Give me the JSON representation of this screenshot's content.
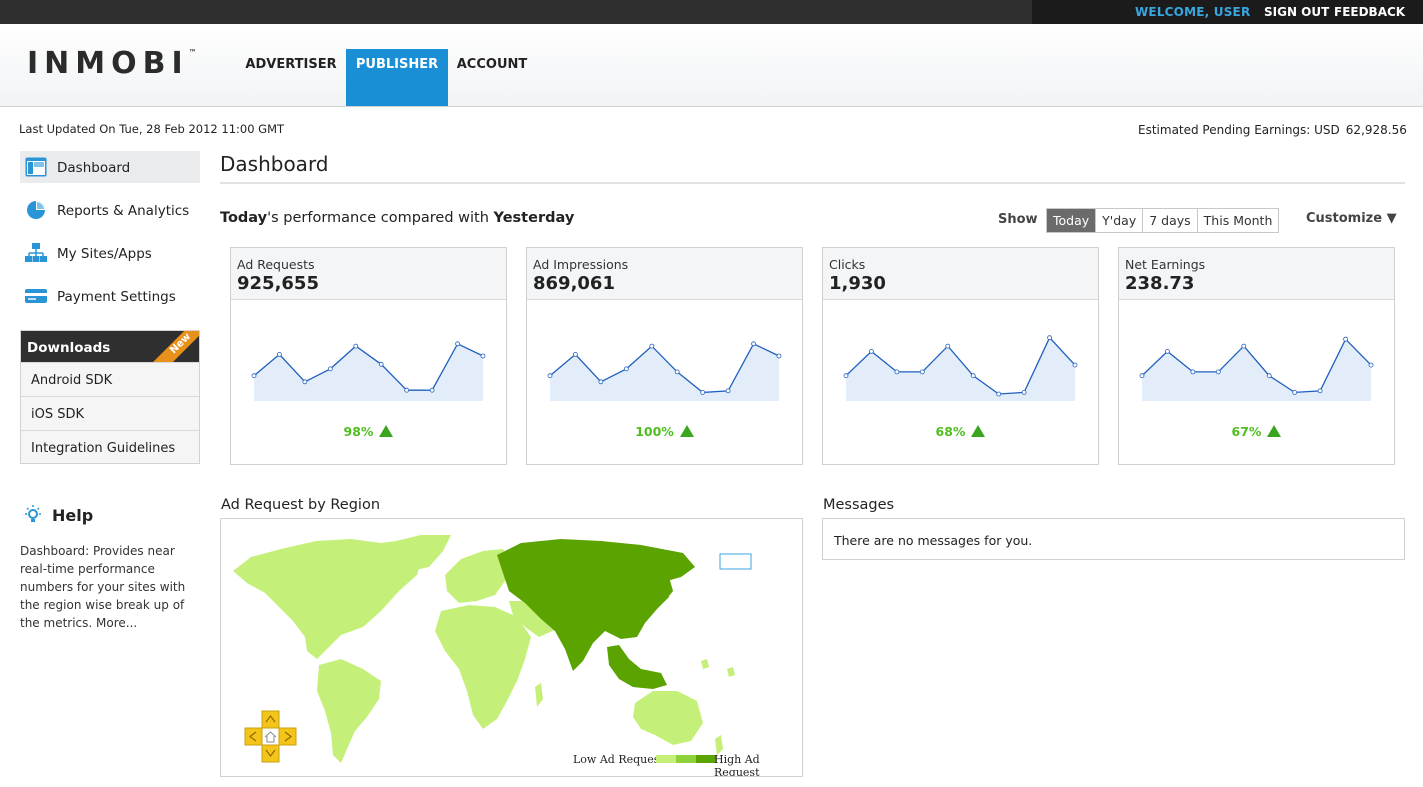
{
  "topbar": {
    "welcome": "WELCOME, USER",
    "sign_out": "SIGN OUT",
    "feedback": "FEEDBACK"
  },
  "header": {
    "logo_text": "INMOBI",
    "logo_tm": "™",
    "tabs": [
      {
        "label": "ADVERTISER",
        "active": false
      },
      {
        "label": "PUBLISHER",
        "active": true
      },
      {
        "label": "ACCOUNT",
        "active": false
      }
    ]
  },
  "status": {
    "last_updated": "Last Updated On Tue, 28 Feb 2012 11:00 GMT",
    "earnings_label": "Estimated Pending Earnings: USD",
    "earnings_value": "62,928.56"
  },
  "sidebar": {
    "items": [
      {
        "label": "Dashboard",
        "icon": "dashboard-icon",
        "active": true
      },
      {
        "label": "Reports & Analytics",
        "icon": "pie-chart-icon",
        "active": false
      },
      {
        "label": "My Sites/Apps",
        "icon": "sitemap-icon",
        "active": false
      },
      {
        "label": "Payment Settings",
        "icon": "credit-card-icon",
        "active": false
      }
    ],
    "downloads": {
      "title": "Downloads",
      "badge": "New",
      "items": [
        "Android SDK",
        "iOS SDK",
        "Integration Guidelines"
      ]
    },
    "help": {
      "title": "Help",
      "text": "Dashboard: Provides near real-time performance numbers for your sites with the region wise break up of the metrics. More..."
    }
  },
  "main": {
    "title": "Dashboard",
    "perf_bold_1": "Today",
    "perf_mid": "'s performance compared with ",
    "perf_bold_2": "Yesterday",
    "show_label": "Show",
    "ranges": [
      {
        "label": "Today",
        "active": true
      },
      {
        "label": "Y'day",
        "active": false
      },
      {
        "label": "7 days",
        "active": false
      },
      {
        "label": "This Month",
        "active": false
      }
    ],
    "customize": "Customize ▼",
    "metrics": [
      {
        "name": "Ad Requests",
        "value": "925,655",
        "change": "98%",
        "trend": [
          0.28,
          0.56,
          0.2,
          0.37,
          0.67,
          0.43,
          0.09,
          0.09,
          0.7,
          0.54
        ]
      },
      {
        "name": "Ad Impressions",
        "value": "869,061",
        "change": "100%",
        "trend": [
          0.28,
          0.56,
          0.2,
          0.37,
          0.67,
          0.33,
          0.06,
          0.08,
          0.7,
          0.54
        ]
      },
      {
        "name": "Clicks",
        "value": "1,930",
        "change": "68%",
        "trend": [
          0.28,
          0.6,
          0.33,
          0.33,
          0.67,
          0.28,
          0.04,
          0.06,
          0.78,
          0.42
        ]
      },
      {
        "name": "Net Earnings",
        "value": "238.73",
        "change": "67%",
        "trend": [
          0.28,
          0.6,
          0.33,
          0.33,
          0.67,
          0.28,
          0.06,
          0.08,
          0.76,
          0.42
        ]
      }
    ],
    "region": {
      "title": "Ad Request by Region",
      "legend_low": "Low Ad Request",
      "legend_high": "High Ad Request",
      "colors": {
        "low": "#c4f07a",
        "mid": "#8fd13a",
        "high": "#5aa300"
      }
    },
    "messages": {
      "title": "Messages",
      "empty_text": "There are no messages for you."
    }
  }
}
